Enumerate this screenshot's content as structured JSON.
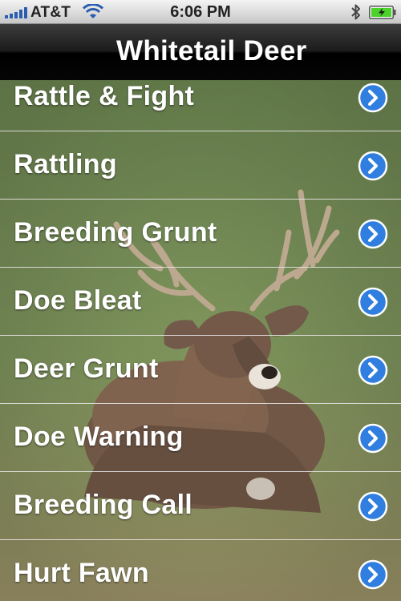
{
  "status_bar": {
    "carrier": "AT&T",
    "time": "6:06 PM",
    "signal_icon": "signal-bars-icon",
    "wifi_icon": "wifi-icon",
    "bluetooth_icon": "bluetooth-icon",
    "battery_icon": "battery-charging-icon",
    "battery_color": "#4bd32a"
  },
  "nav_bar": {
    "title": "Whitetail Deer"
  },
  "list": {
    "items": [
      {
        "label": "Rattle & Fight"
      },
      {
        "label": "Rattling"
      },
      {
        "label": "Breeding Grunt"
      },
      {
        "label": "Doe Bleat"
      },
      {
        "label": "Deer Grunt"
      },
      {
        "label": "Doe Warning"
      },
      {
        "label": "Breeding Call"
      },
      {
        "label": "Hurt Fawn"
      }
    ],
    "accessory_icon": "chevron-right-circle-icon",
    "accessory_color": "#2f7ee0"
  }
}
